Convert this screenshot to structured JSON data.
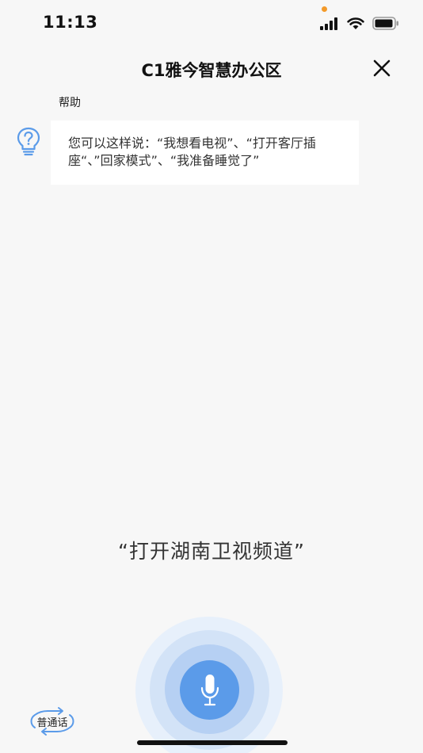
{
  "status_bar": {
    "time": "11:13",
    "icons": [
      "cellular-signal-icon",
      "wifi-icon",
      "battery-icon"
    ],
    "privacy_dot_color": "#f39a2a"
  },
  "header": {
    "title": "C1雅今智慧办公区",
    "close_icon": "close-icon"
  },
  "help": {
    "label": "帮助",
    "icon": "lightbulb-question-icon",
    "text": "您可以这样说：“我想看电视”、“打开客厅插座“、”回家模式”、“我准备睡觉了”"
  },
  "speech": {
    "recognized_text": "“打开湖南卫视频道”"
  },
  "mic": {
    "icon": "microphone-icon",
    "color": "#5b9be9"
  },
  "language_toggle": {
    "label": "普通话",
    "icon": "swap-arrows-icon"
  },
  "colors": {
    "accent": "#5b9be9",
    "background": "#f7f7f7"
  }
}
